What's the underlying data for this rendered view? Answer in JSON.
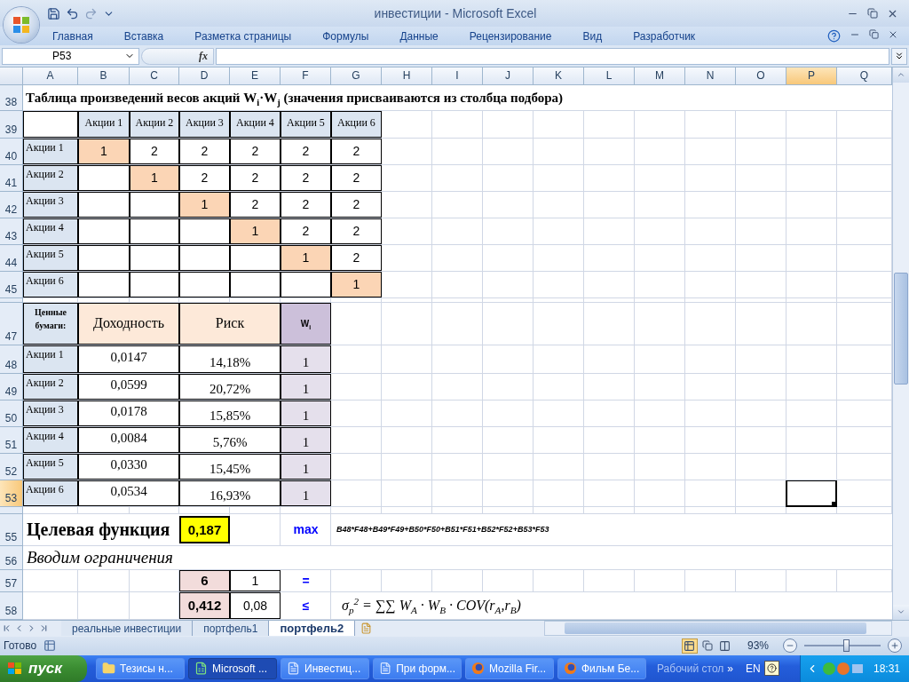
{
  "window": {
    "title": "инвестиции - Microsoft Excel"
  },
  "ribbon_tabs": [
    "Главная",
    "Вставка",
    "Разметка страницы",
    "Формулы",
    "Данные",
    "Рецензирование",
    "Вид",
    "Разработчик"
  ],
  "name_box": "P53",
  "formula_icon": "fx",
  "columns": [
    {
      "label": "A",
      "selected": false
    },
    {
      "label": "B",
      "selected": false
    },
    {
      "label": "C",
      "selected": false
    },
    {
      "label": "D",
      "selected": false
    },
    {
      "label": "E",
      "selected": false
    },
    {
      "label": "F",
      "selected": false
    },
    {
      "label": "G",
      "selected": false
    },
    {
      "label": "H",
      "selected": false
    },
    {
      "label": "I",
      "selected": false
    },
    {
      "label": "J",
      "selected": false
    },
    {
      "label": "K",
      "selected": false
    },
    {
      "label": "L",
      "selected": false
    },
    {
      "label": "M",
      "selected": false
    },
    {
      "label": "N",
      "selected": false
    },
    {
      "label": "O",
      "selected": false
    },
    {
      "label": "P",
      "selected": true
    },
    {
      "label": "Q",
      "selected": false
    }
  ],
  "rows": [
    {
      "kind": "normal",
      "number": "38",
      "selected": false,
      "cells": [
        {
          "kind": "title",
          "text": "Таблица произведений весов акций W$_{i}$·W$_{j}$ (значения присваиваются из столбца подбора)"
        }
      ]
    },
    {
      "kind": "normal",
      "number": "39",
      "selected": false,
      "cells": [
        {
          "kind": "box"
        },
        {
          "kind": "column-label",
          "text": "Акции 1"
        },
        {
          "kind": "column-label",
          "text": "Акции 2"
        },
        {
          "kind": "column-label",
          "text": "Акции 3"
        },
        {
          "kind": "column-label",
          "text": "Акции 4"
        },
        {
          "kind": "column-label",
          "text": "Акции 5"
        },
        {
          "kind": "column-label",
          "text": "Акции 6"
        }
      ]
    },
    {
      "kind": "normal",
      "number": "40",
      "selected": false,
      "cells": [
        {
          "kind": "label",
          "text": "Акции 1"
        },
        {
          "kind": "diag",
          "text": "1"
        },
        {
          "kind": "value",
          "text": "2"
        },
        {
          "kind": "value",
          "text": "2"
        },
        {
          "kind": "value",
          "text": "2"
        },
        {
          "kind": "value",
          "text": "2"
        },
        {
          "kind": "value",
          "text": "2"
        }
      ]
    },
    {
      "kind": "normal",
      "number": "41",
      "selected": false,
      "cells": [
        {
          "kind": "label",
          "text": "Акции 2"
        },
        {
          "kind": "box"
        },
        {
          "kind": "diag",
          "text": "1"
        },
        {
          "kind": "value",
          "text": "2"
        },
        {
          "kind": "value",
          "text": "2"
        },
        {
          "kind": "value",
          "text": "2"
        },
        {
          "kind": "value",
          "text": "2"
        }
      ]
    },
    {
      "kind": "normal",
      "number": "42",
      "selected": false,
      "cells": [
        {
          "kind": "label",
          "text": "Акции 3"
        },
        {
          "kind": "box"
        },
        {
          "kind": "box"
        },
        {
          "kind": "diag",
          "text": "1"
        },
        {
          "kind": "value",
          "text": "2"
        },
        {
          "kind": "value",
          "text": "2"
        },
        {
          "kind": "value",
          "text": "2"
        }
      ]
    },
    {
      "kind": "normal",
      "number": "43",
      "selected": false,
      "cells": [
        {
          "kind": "label",
          "text": "Акции 4"
        },
        {
          "kind": "box"
        },
        {
          "kind": "box"
        },
        {
          "kind": "box"
        },
        {
          "kind": "diag",
          "text": "1"
        },
        {
          "kind": "value",
          "text": "2"
        },
        {
          "kind": "value",
          "text": "2"
        }
      ]
    },
    {
      "kind": "normal",
      "number": "44",
      "selected": false,
      "cells": [
        {
          "kind": "label",
          "text": "Акции 5"
        },
        {
          "kind": "box"
        },
        {
          "kind": "box"
        },
        {
          "kind": "box"
        },
        {
          "kind": "box"
        },
        {
          "kind": "diag",
          "text": "1"
        },
        {
          "kind": "value",
          "text": "2"
        }
      ]
    },
    {
      "kind": "normal",
      "number": "45",
      "selected": false,
      "cells": [
        {
          "kind": "label",
          "text": "Акции 6"
        },
        {
          "kind": "box"
        },
        {
          "kind": "box"
        },
        {
          "kind": "box"
        },
        {
          "kind": "box"
        },
        {
          "kind": "box"
        },
        {
          "kind": "diag",
          "text": "1"
        }
      ]
    },
    {
      "kind": "thin"
    },
    {
      "kind": "normal",
      "number": "47",
      "selected": false,
      "cells": [
        {
          "kind": "label-bold",
          "text": "Ценные бумаги:"
        },
        {
          "kind": "head-peach",
          "merged": true,
          "text": "Доходность"
        },
        {
          "kind": "head-peach",
          "merged": true,
          "text": "Риск"
        },
        {
          "kind": "head-lilac",
          "text": "W$_{i}$"
        }
      ]
    },
    {
      "kind": "normal",
      "number": "48",
      "selected": false,
      "cells": [
        {
          "kind": "label",
          "text": "Акции 1"
        },
        {
          "kind": "number",
          "merged": true,
          "text": "0,0147"
        },
        {
          "kind": "number-low",
          "merged": true,
          "text": "14,18%"
        },
        {
          "kind": "lilac",
          "text": "1"
        }
      ]
    },
    {
      "kind": "normal",
      "number": "49",
      "selected": false,
      "cells": [
        {
          "kind": "label",
          "text": "Акции 2"
        },
        {
          "kind": "number",
          "merged": true,
          "text": "0,0599"
        },
        {
          "kind": "number-low",
          "merged": true,
          "text": "20,72%"
        },
        {
          "kind": "lilac",
          "text": "1"
        }
      ]
    },
    {
      "kind": "normal",
      "number": "50",
      "selected": false,
      "cells": [
        {
          "kind": "label",
          "text": "Акции 3"
        },
        {
          "kind": "number",
          "merged": true,
          "text": "0,0178"
        },
        {
          "kind": "number-low",
          "merged": true,
          "text": "15,85%"
        },
        {
          "kind": "lilac",
          "text": "1"
        }
      ]
    },
    {
      "kind": "normal",
      "number": "51",
      "selected": false,
      "cells": [
        {
          "kind": "label",
          "text": "Акции 4"
        },
        {
          "kind": "number",
          "merged": true,
          "text": "0,0084"
        },
        {
          "kind": "number-low",
          "merged": true,
          "text": "5,76%"
        },
        {
          "kind": "lilac",
          "text": "1"
        }
      ]
    },
    {
      "kind": "normal",
      "number": "52",
      "selected": false,
      "cells": [
        {
          "kind": "label",
          "text": "Акции 5"
        },
        {
          "kind": "number",
          "merged": true,
          "text": "0,0330"
        },
        {
          "kind": "number-low",
          "merged": true,
          "text": "15,45%"
        },
        {
          "kind": "lilac",
          "text": "1"
        }
      ]
    },
    {
      "kind": "normal",
      "number": "53",
      "selected": true,
      "cells": [
        {
          "kind": "label",
          "text": "Акции 6"
        },
        {
          "kind": "number",
          "merged": true,
          "text": "0,0534"
        },
        {
          "kind": "number-low",
          "merged": true,
          "text": "16,93%"
        },
        {
          "kind": "lilac",
          "text": "1"
        }
      ]
    },
    {
      "kind": "thin"
    },
    {
      "kind": "normal",
      "number": "55",
      "selected": false,
      "cells": [
        {
          "kind": "heading",
          "text": "Целевая функция"
        },
        {
          "kind": "gap"
        },
        {
          "kind": "gap"
        },
        {
          "kind": "yellow",
          "text": "0,187"
        },
        {
          "kind": "gap"
        },
        {
          "kind": "blue",
          "text": "max"
        },
        {
          "kind": "note",
          "text": "B48*F48+B49*F49+B50*F50+B51*F51+B52*F52+B53*F53"
        }
      ]
    },
    {
      "kind": "normal",
      "number": "56",
      "selected": false,
      "cells": [
        {
          "kind": "italic",
          "text": "Вводим ограничения"
        }
      ]
    },
    {
      "kind": "normal",
      "number": "57",
      "selected": false,
      "cells": [
        {
          "kind": "gap"
        },
        {
          "kind": "gap"
        },
        {
          "kind": "gap"
        },
        {
          "kind": "pink",
          "text": "6"
        },
        {
          "kind": "value",
          "text": "1"
        },
        {
          "kind": "blue",
          "text": "="
        }
      ]
    },
    {
      "kind": "normal",
      "number": "58",
      "selected": false,
      "cells": [
        {
          "kind": "gap"
        },
        {
          "kind": "gap"
        },
        {
          "kind": "gap"
        },
        {
          "kind": "pink",
          "text": "0,412"
        },
        {
          "kind": "value",
          "text": "0,08"
        },
        {
          "kind": "blue",
          "text": "≤"
        },
        {
          "kind": "formula",
          "text": "σ$_{p}$$^{2}$ = ∑∑ W$_{A}$ · W$_{B}$ · COV(r$_{A}$,r$_{B}$)"
        }
      ]
    }
  ],
  "sheet_tabs": [
    {
      "label": "реальные инвестиции",
      "selected": false
    },
    {
      "label": "портфель1",
      "selected": false
    },
    {
      "label": "портфель2",
      "selected": true
    }
  ],
  "status_bar": {
    "text": "Готово",
    "views": [
      {
        "kind": "normal",
        "selected": true
      },
      {
        "kind": "layout",
        "selected": false
      },
      {
        "kind": "page-break",
        "selected": false
      }
    ],
    "zoom": "93%",
    "zoom_slider": {
      "level": 0.55
    }
  },
  "taskbar": {
    "start": "пуск",
    "items": [
      {
        "kind": "folder",
        "label": "Тезисы н...",
        "selected": false
      },
      {
        "kind": "excel",
        "label": "Microsoft ...",
        "selected": true
      },
      {
        "kind": "word",
        "label": "Инвестиц...",
        "selected": false
      },
      {
        "kind": "word",
        "label": "При форм...",
        "selected": false
      },
      {
        "kind": "firefox",
        "label": "Mozilla Fir...",
        "selected": false
      },
      {
        "kind": "firefox",
        "label": "Фильм Бе...",
        "selected": false
      }
    ],
    "desktop": "Рабочий стол",
    "chevron": "»",
    "language": "EN",
    "clock": "18:31"
  }
}
